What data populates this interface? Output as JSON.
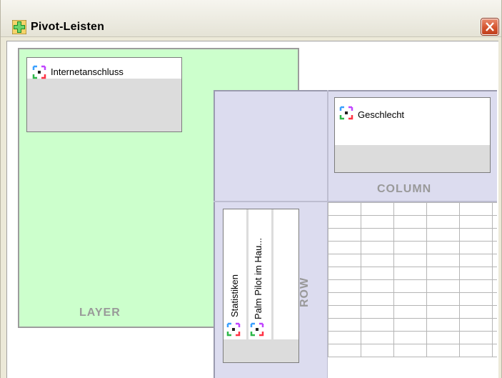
{
  "window": {
    "title": "Pivot-Leisten"
  },
  "layer": {
    "area_label": "LAYER",
    "items": [
      {
        "label": "Internetanschluss",
        "icon": "pivot-variable-icon"
      }
    ]
  },
  "column": {
    "area_label": "COLUMN",
    "items": [
      {
        "label": "Geschlecht",
        "icon": "pivot-variable-icon"
      }
    ]
  },
  "row": {
    "area_label": "ROW",
    "items": [
      {
        "label": "Statistiken",
        "icon": "pivot-variable-icon"
      },
      {
        "label": "Palm Pilot im Hau...",
        "icon": "pivot-variable-icon"
      }
    ]
  },
  "colors": {
    "layer_background": "#ccffcc",
    "pivot_background": "#dcdcef",
    "area_label": "#999999",
    "close_button": "#d4542f"
  }
}
